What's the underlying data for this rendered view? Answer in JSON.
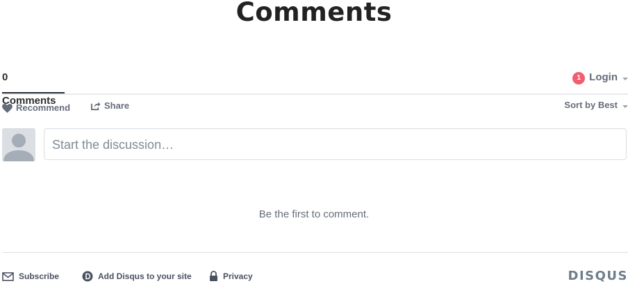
{
  "page": {
    "heading": "Comments"
  },
  "nav": {
    "comment_count_tab": "0 Comments",
    "login_label": "Login",
    "notification_count": "1"
  },
  "toolbar": {
    "recommend_label": "Recommend",
    "share_label": "Share",
    "sort_label": "Sort by Best"
  },
  "composer": {
    "placeholder": "Start the discussion…"
  },
  "empty_state": {
    "message": "Be the first to comment."
  },
  "footer": {
    "subscribe_label": "Subscribe",
    "add_disqus_label": "Add Disqus to your site",
    "privacy_label": "Privacy",
    "logo_text": "DISQUS"
  },
  "colors": {
    "badge": "#f05f70",
    "text_primary": "#2a2e2e",
    "text_muted": "#656c7a",
    "logo": "#6e7d8b",
    "border": "#dbdfe4"
  },
  "icons": {
    "recommend": "heart-icon",
    "share": "share-icon",
    "subscribe": "envelope-icon",
    "add_disqus": "disqus-d-icon",
    "privacy": "lock-icon",
    "avatar": "user-avatar-placeholder"
  }
}
